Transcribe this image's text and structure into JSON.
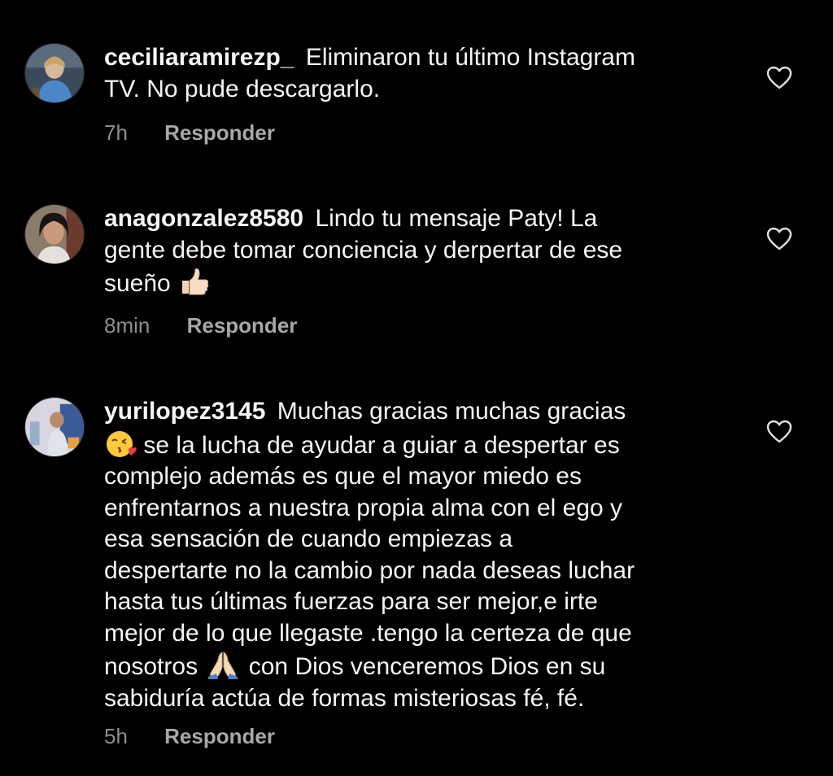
{
  "comments": [
    {
      "username": "ceciliaramirezp_",
      "lines": [
        " Eliminaron tu último Instagram",
        "TV. No pude descargarlo."
      ],
      "time": "7h",
      "reply_label": "Responder"
    },
    {
      "username": "anagonzalez8580",
      "lines": [
        " Lindo tu mensaje Paty! La",
        "gente debe tomar conciencia y derpertar de ese",
        "sueño "
      ],
      "emoji": "thumbs-up-icon",
      "time": "8min",
      "reply_label": "Responder"
    },
    {
      "username": "yurilopez3145",
      "lines": [
        " Muchas gracias muchas gracias",
        " se la lucha de ayudar a guiar a despertar es",
        "complejo además es que el mayor miedo es",
        "enfrentarnos a nuestra propia alma con el ego y",
        "esa sensación de cuando empiezas a",
        "despertarte no la cambio por nada deseas luchar",
        "hasta tus últimas fuerzas para ser mejor,e irte",
        "mejor de lo  que llegaste .tengo la certeza de que",
        "nosotros ",
        " con Dios venceremos Dios en su",
        "sabiduría actúa de formas misteriosas fé, fé."
      ],
      "emojis": [
        "kiss-face-icon",
        "praying-hands-icon"
      ],
      "time": "5h",
      "reply_label": "Responder"
    }
  ],
  "colors": {
    "background": "#000000",
    "text": "#f5f5f5",
    "meta": "#8e8e8e",
    "reply": "#a8a8a8"
  },
  "icons": [
    "heart-outline-icon"
  ]
}
